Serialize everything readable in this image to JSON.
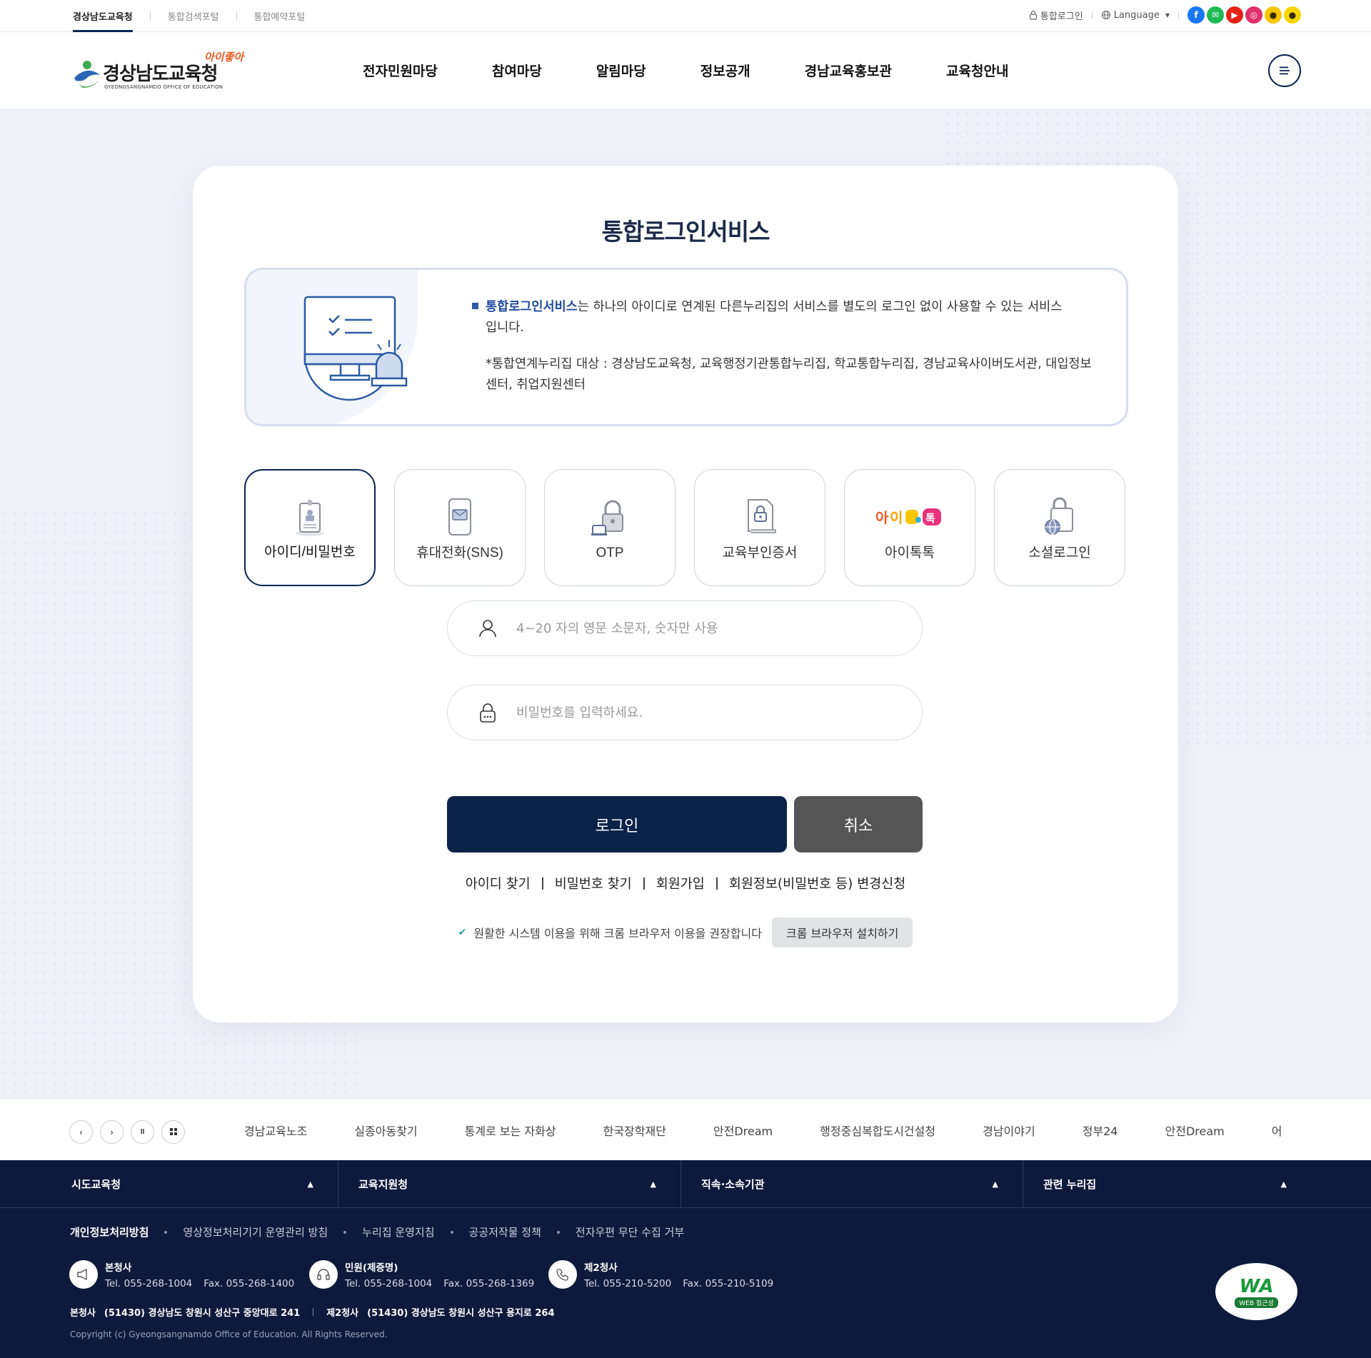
{
  "util": {
    "tabs": [
      "경상남도교육청",
      "통합검색포털",
      "통합예약포털"
    ],
    "login": "통합로그인",
    "language": "Language",
    "sns": [
      {
        "name": "facebook-icon",
        "glyph": "f",
        "color": "#1877f2"
      },
      {
        "name": "line-icon",
        "glyph": "✉",
        "color": "#1db954"
      },
      {
        "name": "youtube-icon",
        "glyph": "▶",
        "color": "#e62117"
      },
      {
        "name": "instagram-icon",
        "glyph": "◎",
        "color": "#e1306c"
      },
      {
        "name": "kakaostory-icon",
        "glyph": "●",
        "color": "#f7c600"
      },
      {
        "name": "kakaotalk-icon",
        "glyph": "●",
        "color": "#f7d600"
      }
    ]
  },
  "header": {
    "logo_name": "경상남도교육청",
    "logo_eng": "GYEONGSANGNAMDO OFFICE OF EDUCATION",
    "logo_slogan": "아이좋아",
    "nav": [
      "전자민원마당",
      "참여마당",
      "알림마당",
      "정보공개",
      "경남교육홍보관",
      "교육청안내"
    ]
  },
  "login": {
    "title": "통합로그인서비스",
    "info_highlight": "통합로그인서비스",
    "info_text": "는 하나의 아이디로 연계된 다른누리집의 서비스를 별도의 로그인 없이 사용할 수 있는 서비스 입니다.",
    "info_targets": "*통합연계누리집 대상 : 경상남도교육청, 교육행정기관통합누리집, 학교통합누리집, 경남교육사이버도서관, 대입정보센터, 취업지원센터",
    "methods": [
      "아이디/비밀번호",
      "휴대전화(SNS)",
      "OTP",
      "교육부인증서",
      "아이톡톡",
      "소셜로그인"
    ],
    "active_method": "아이디/비밀번호",
    "id_placeholder": "4~20 자의 영문 소문자, 숫자만 사용",
    "pw_placeholder": "비밀번호를 입력하세요.",
    "login_btn": "로그인",
    "cancel_btn": "취소",
    "links": [
      "아이디 찾기",
      "비밀번호 찾기",
      "회원가입",
      "회원정보(비밀번호 등) 변경신청"
    ],
    "chrome_notice": "원활한 시스템 이용을 위해 크롬 브라우저 이용을 권장합니다",
    "chrome_btn": "크롬 브라우저 설치하기"
  },
  "banner": {
    "items": [
      "경남교육노조",
      "실종아동찾기",
      "통계로 보는 자화상",
      "한국장학재단",
      "안전Dream",
      "행정중심복합도시건설청",
      "경남이야기",
      "정부24",
      "안전Dream",
      "어린이 문화"
    ]
  },
  "footer": {
    "selects": [
      "시도교육청",
      "교육지원청",
      "직속·소속기관",
      "관련 누리집"
    ],
    "policies": [
      "개인정보처리방침",
      "영상정보처리기기 운영관리 방침",
      "누리집 운영지침",
      "공공저작물 정책",
      "전자우편 무단 수집 거부"
    ],
    "contacts": [
      {
        "title": "본청사",
        "tel": "Tel. 055-268-1004",
        "fax": "Fax. 055-268-1400"
      },
      {
        "title": "민원(제증명)",
        "tel": "Tel. 055-268-1004",
        "fax": "Fax. 055-268-1369"
      },
      {
        "title": "제2청사",
        "tel": "Tel. 055-210-5200",
        "fax": "Fax. 055-210-5109"
      }
    ],
    "addr1_label": "본청사",
    "addr1": "(51430) 경상남도 창원시 성산구 중앙대로 241",
    "addr2_label": "제2청사",
    "addr2": "(51430) 경상남도 창원시 성산구 용지로 264",
    "copyright": "Copyright (c) Gyeongsangnamdo Office of Education. All Rights Reserved.",
    "wa_label": "WA",
    "wa_sub": "WEB 접근성"
  }
}
